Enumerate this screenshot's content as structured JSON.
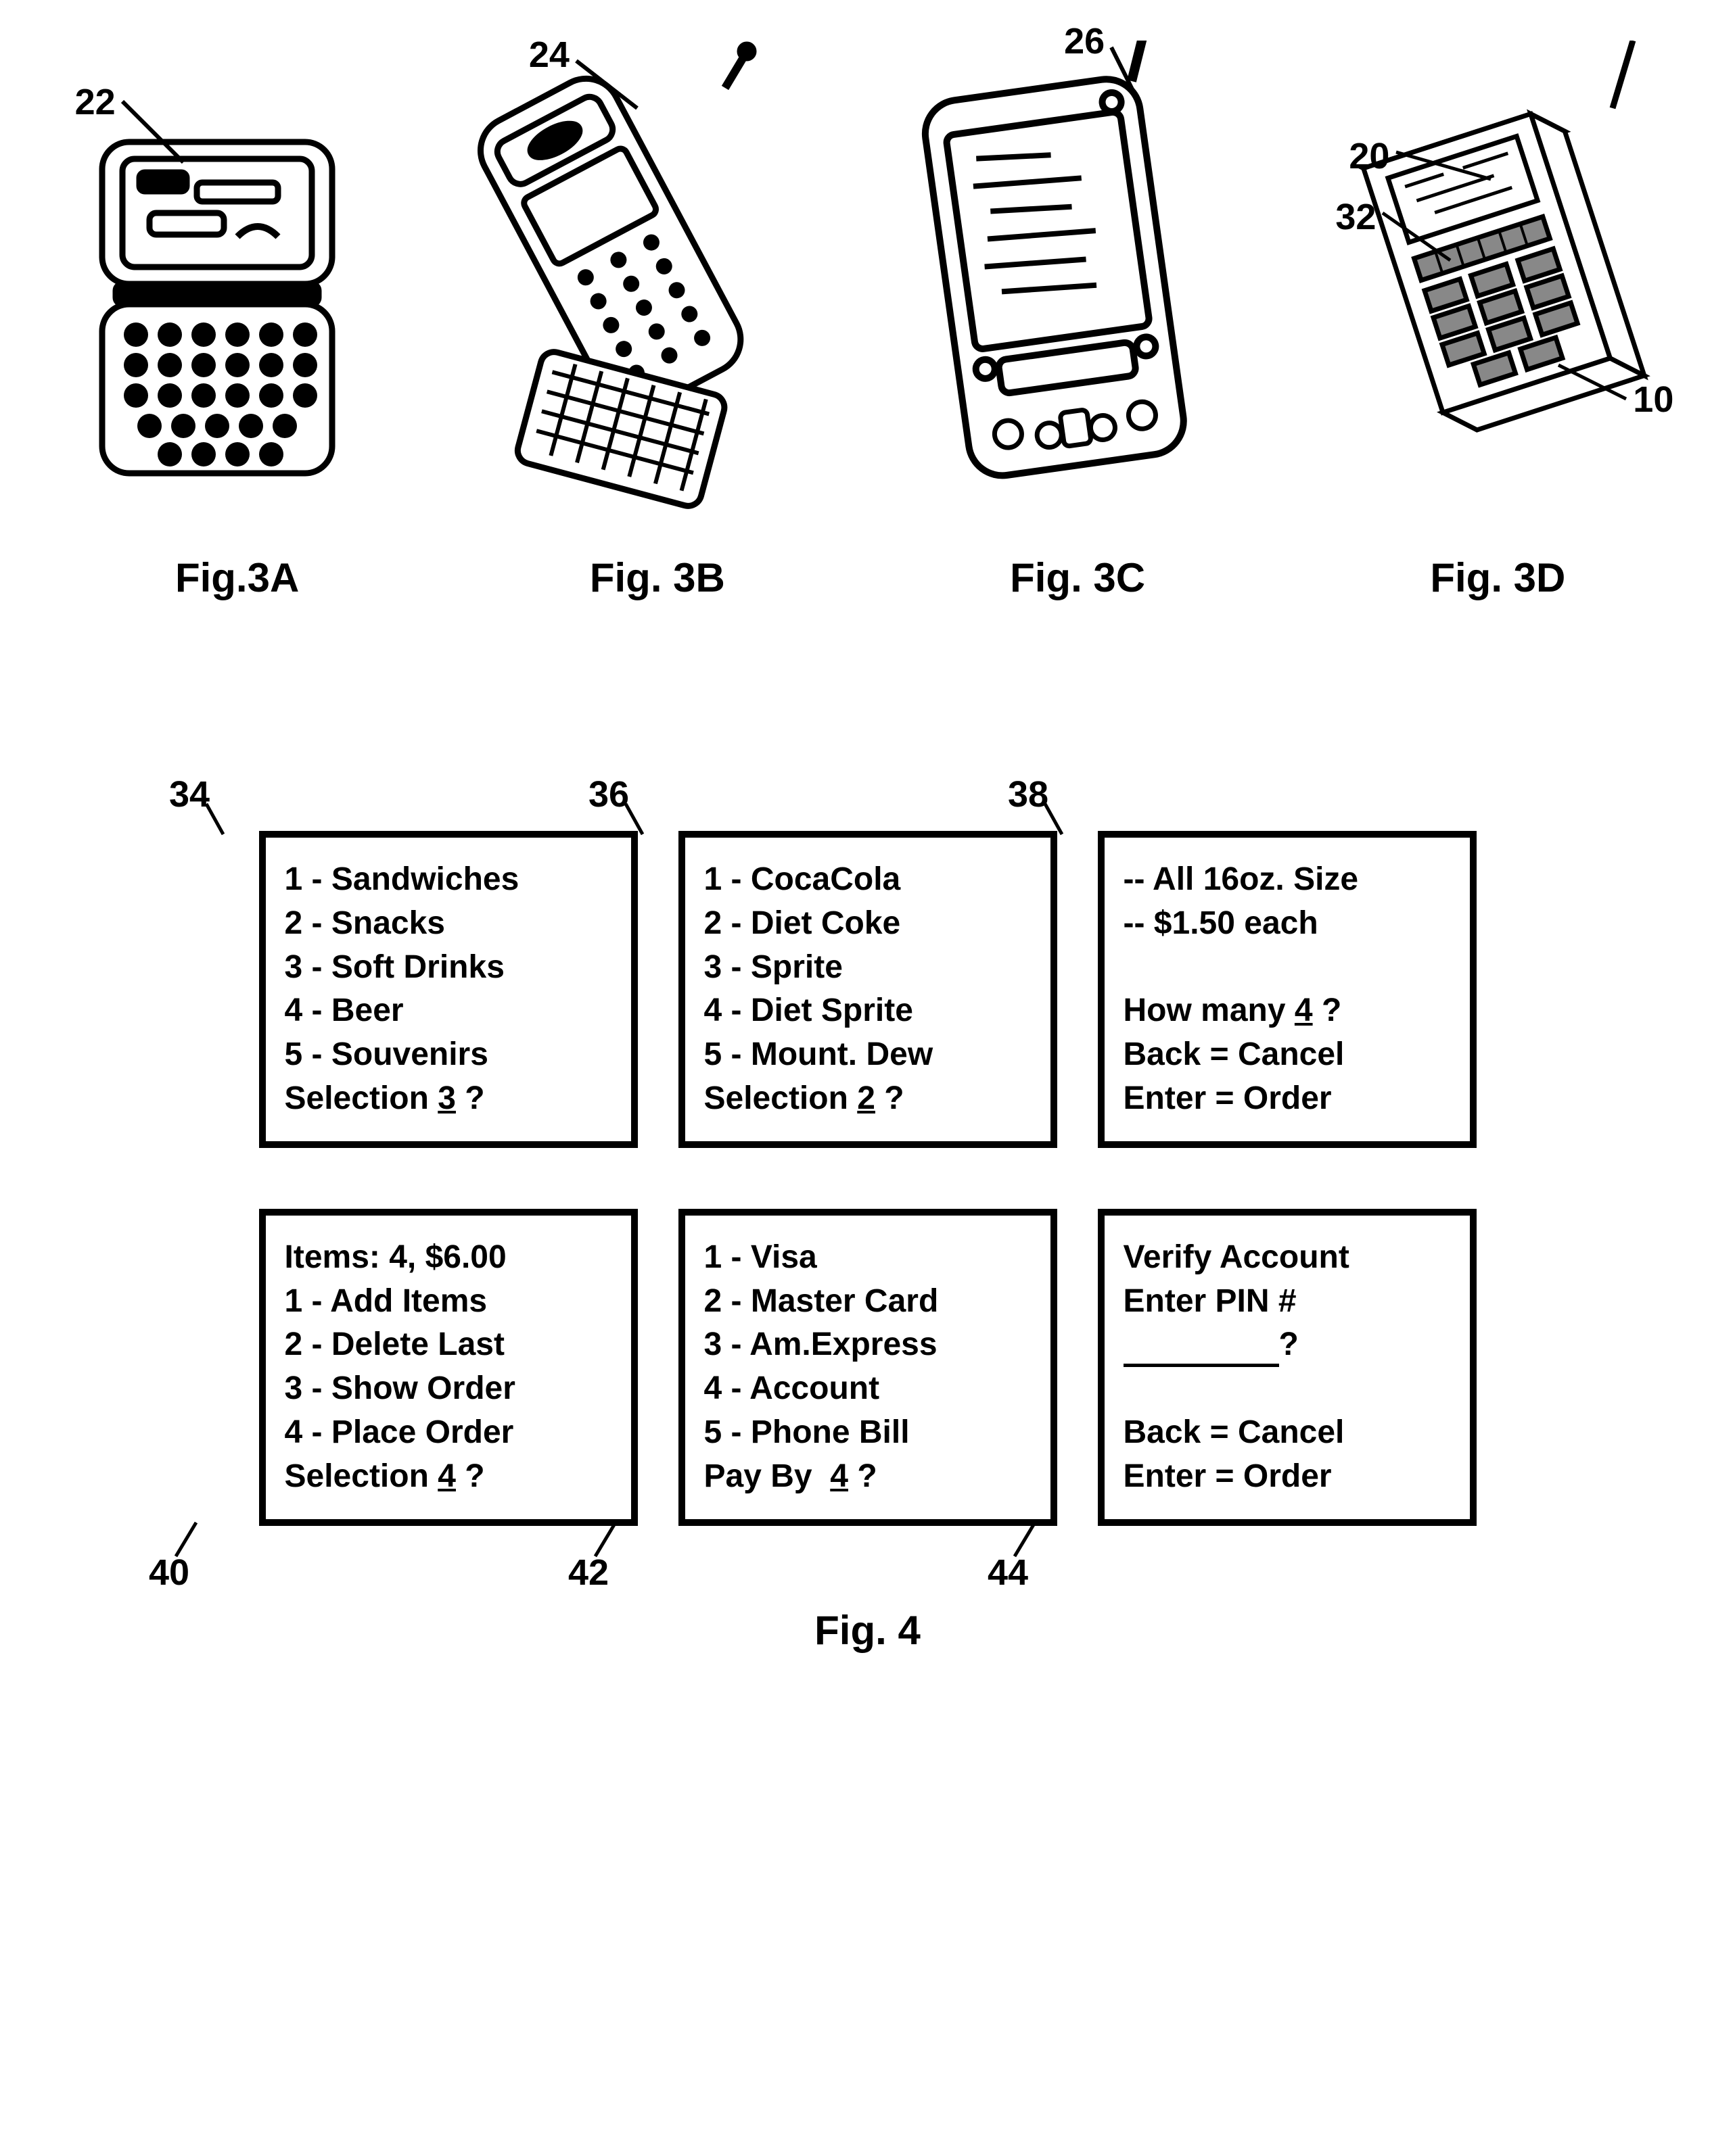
{
  "devices": [
    {
      "ref": "22",
      "caption": "Fig.3A"
    },
    {
      "ref": "24",
      "caption": "Fig. 3B"
    },
    {
      "ref": "26",
      "caption": "Fig. 3C"
    },
    {
      "ref_a": "20",
      "ref_b": "32",
      "ref_c": "10",
      "caption": "Fig. 3D"
    }
  ],
  "screens": {
    "s34": {
      "ref": "34",
      "lines": [
        "1 - Sandwiches",
        "2 - Snacks",
        "3 - Soft Drinks",
        "4 - Beer",
        "5 - Souvenirs"
      ],
      "prompt_prefix": "Selection",
      "prompt_value": "3",
      "prompt_suffix": "?"
    },
    "s36": {
      "ref": "36",
      "lines": [
        "1 - CocaCola",
        "2 - Diet Coke",
        "3 - Sprite",
        "4 - Diet Sprite",
        "5 - Mount. Dew"
      ],
      "prompt_prefix": "Selection",
      "prompt_value": "2",
      "prompt_suffix": "?"
    },
    "s38": {
      "ref": "38",
      "lines_top": [
        "-- All 16oz. Size",
        "-- $1.50 each"
      ],
      "prompt_prefix": "How many",
      "prompt_value": "4",
      "prompt_suffix": "?",
      "lines_bottom": [
        "Back = Cancel",
        "Enter = Order"
      ]
    },
    "s40": {
      "ref": "40",
      "header": "Items: 4, $6.00",
      "lines": [
        "1 - Add Items",
        "2 - Delete Last",
        "3 - Show Order",
        "4 - Place Order"
      ],
      "prompt_prefix": "Selection",
      "prompt_value": "4",
      "prompt_suffix": "?"
    },
    "s42": {
      "ref": "42",
      "lines": [
        "1 - Visa",
        "2 - Master Card",
        "3 - Am.Express",
        "4 - Account",
        "5 - Phone Bill"
      ],
      "prompt_prefix": "Pay By ",
      "prompt_value": "4",
      "prompt_suffix": "?"
    },
    "s44": {
      "ref": "44",
      "lines_top": [
        "Verify Account",
        "Enter PIN #"
      ],
      "blankprompt": "?",
      "lines_bottom": [
        "Back = Cancel",
        "Enter = Order"
      ]
    }
  },
  "fig4": "Fig. 4"
}
